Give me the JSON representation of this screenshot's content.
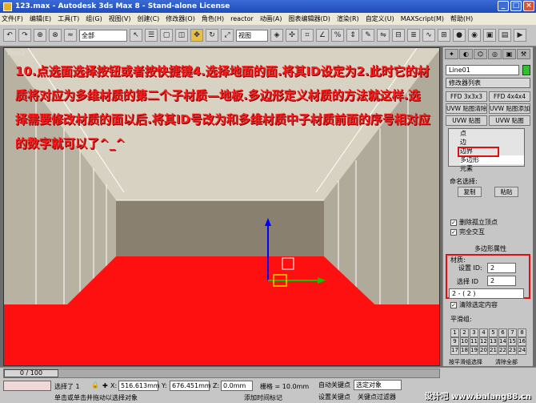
{
  "window": {
    "title": "123.max - Autodesk 3ds Max 8 - Stand-alone License"
  },
  "menu": [
    "文件(F)",
    "编辑(E)",
    "工具(T)",
    "组(G)",
    "视图(V)",
    "创建(C)",
    "修改器(O)",
    "角色(H)",
    "reactor",
    "动画(A)",
    "图表编辑器(D)",
    "渲染(R)",
    "自定义(U)",
    "MAXScript(M)",
    "帮助(H)"
  ],
  "toolbar": {
    "selection_filter": "全部",
    "ref_coord": "视图"
  },
  "viewport": {
    "label": "Fron2",
    "instructions": "10.点选面选择按钮或者按快捷键4.选择地面的面.将其ID设定为2.此时它的材质将对应为多维材质的第二个子材质—地板.多边形定义材质的方法就这样.选择需要修改材质的面以后.将其ID号改为和多维材质中子材质前面的序号相对应的数字就可以了^_^"
  },
  "panel": {
    "object_name": "Line01",
    "modifier_list": "修改器列表",
    "buttons": [
      "FFD 3x3x3",
      "FFD 4x4x4",
      "UVW 贴图清除",
      "UVW 贴图添加",
      "UVW 贴图",
      "UVW 贴图"
    ],
    "stack": [
      "点",
      "边",
      "边界",
      "多边形",
      "元素"
    ],
    "selected_stack_item": "多边形",
    "named_sel_label": "命名选择:",
    "copy_label": "复制",
    "paste_label": "粘贴",
    "delete_isolated": "删除孤立顶点",
    "full_cross": "完全交互",
    "rollout_title": "多边形属性",
    "material_label": "材质:",
    "set_id_label": "设置 ID:",
    "set_id_value": "2",
    "select_id_label": "选择 ID",
    "select_id_value": "2",
    "sub_material": "2 - ( 2 )",
    "clear_selection": "清除选定内容",
    "smoothing_label": "平滑组:",
    "smoothing_numbers": [
      "1",
      "2",
      "3",
      "4",
      "5",
      "6",
      "7",
      "8",
      "9",
      "10",
      "11",
      "12",
      "13",
      "14",
      "15",
      "16",
      "17",
      "18",
      "19",
      "20",
      "21",
      "22",
      "23",
      "24"
    ],
    "select_by_sg": "按平滑组选择",
    "clear_all": "清除全部"
  },
  "status": {
    "frame": "0 / 100",
    "selected": "选择了 1",
    "x": "516.613mm",
    "y": "676.451mm",
    "z": "0.0mm",
    "grid": "栅格 = 10.0mm",
    "auto_key": "自动关键点",
    "set_key": "设置关键点",
    "selected_obj": "选定对象",
    "key_filters": "关键点过滤器",
    "prompt": "单击或单击并拖动以选择对象",
    "add_time_tag": "添加时间标记"
  },
  "watermark": "设计吧 www.balang88.cn"
}
